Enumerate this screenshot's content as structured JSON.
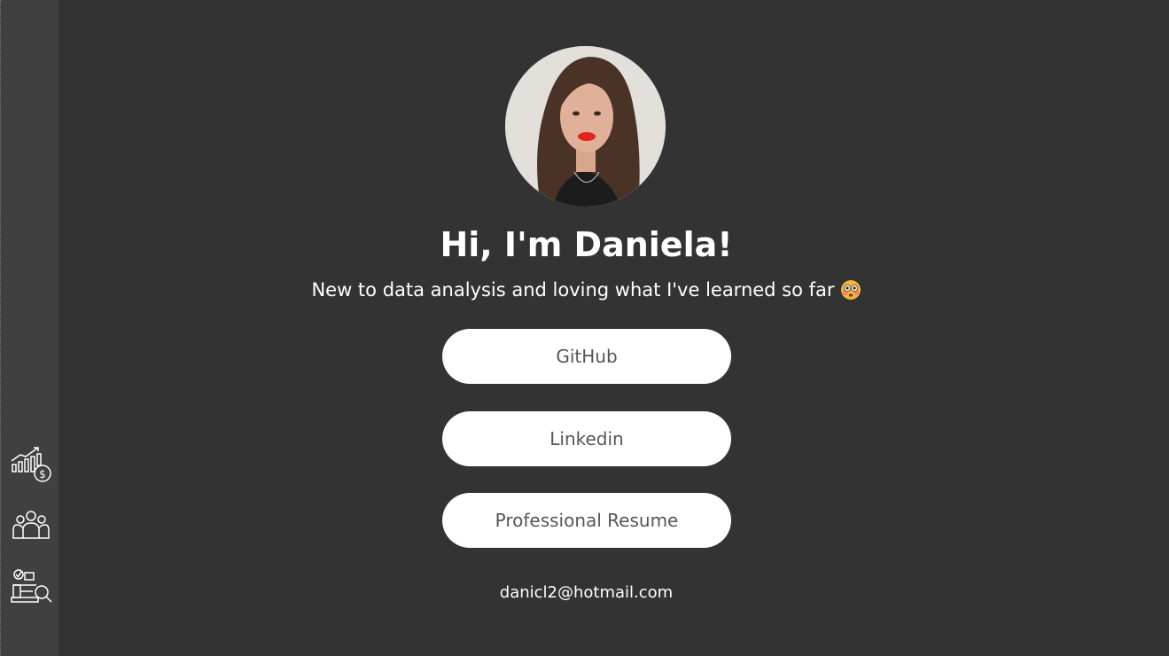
{
  "sidebar": {
    "items": [
      {
        "icon": "growth-chart-dollar-icon"
      },
      {
        "icon": "team-people-icon"
      },
      {
        "icon": "analysis-magnifier-icon"
      }
    ]
  },
  "profile": {
    "avatar_icon": "profile-photo",
    "title": "Hi, I'm Daniela!",
    "subtitle": "New to data analysis and loving what I've learned so far",
    "subtitle_emoji": "flushed-face-emoji"
  },
  "links": {
    "github_label": "GitHub",
    "linkedin_label": "Linkedin",
    "resume_label": "Professional Resume"
  },
  "contact": {
    "email": "danicl2@hotmail.com"
  },
  "colors": {
    "background": "#333333",
    "sidebar": "#404040",
    "button_bg": "#ffffff",
    "button_text": "#555555",
    "text": "#ffffff"
  }
}
